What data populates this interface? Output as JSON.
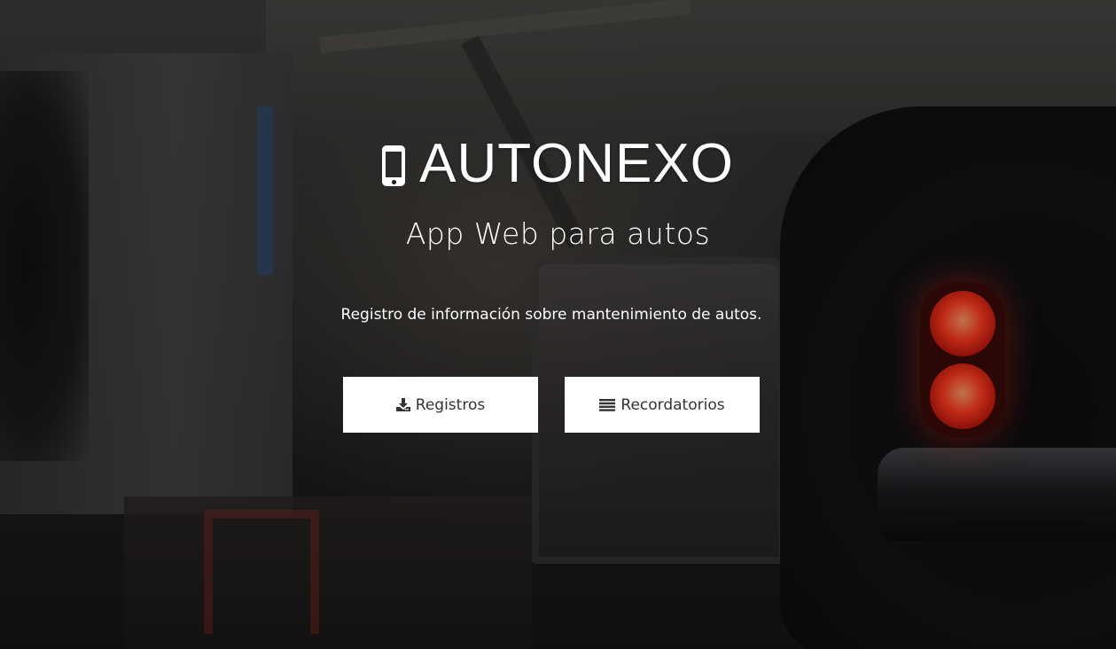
{
  "hero": {
    "title": "AUTONEXO",
    "title_icon": "mobile-phone-icon",
    "subtitle": "App Web para autos",
    "description": "Registro de información sobre mantenimiento de autos."
  },
  "buttons": [
    {
      "label": "Registros",
      "icon": "download-icon"
    },
    {
      "label": "Recordatorios",
      "icon": "list-icon"
    }
  ],
  "colors": {
    "button_background": "#ffffff",
    "button_text": "#333333",
    "hero_text": "#ffffff",
    "taillight": "#ff3a1e"
  }
}
